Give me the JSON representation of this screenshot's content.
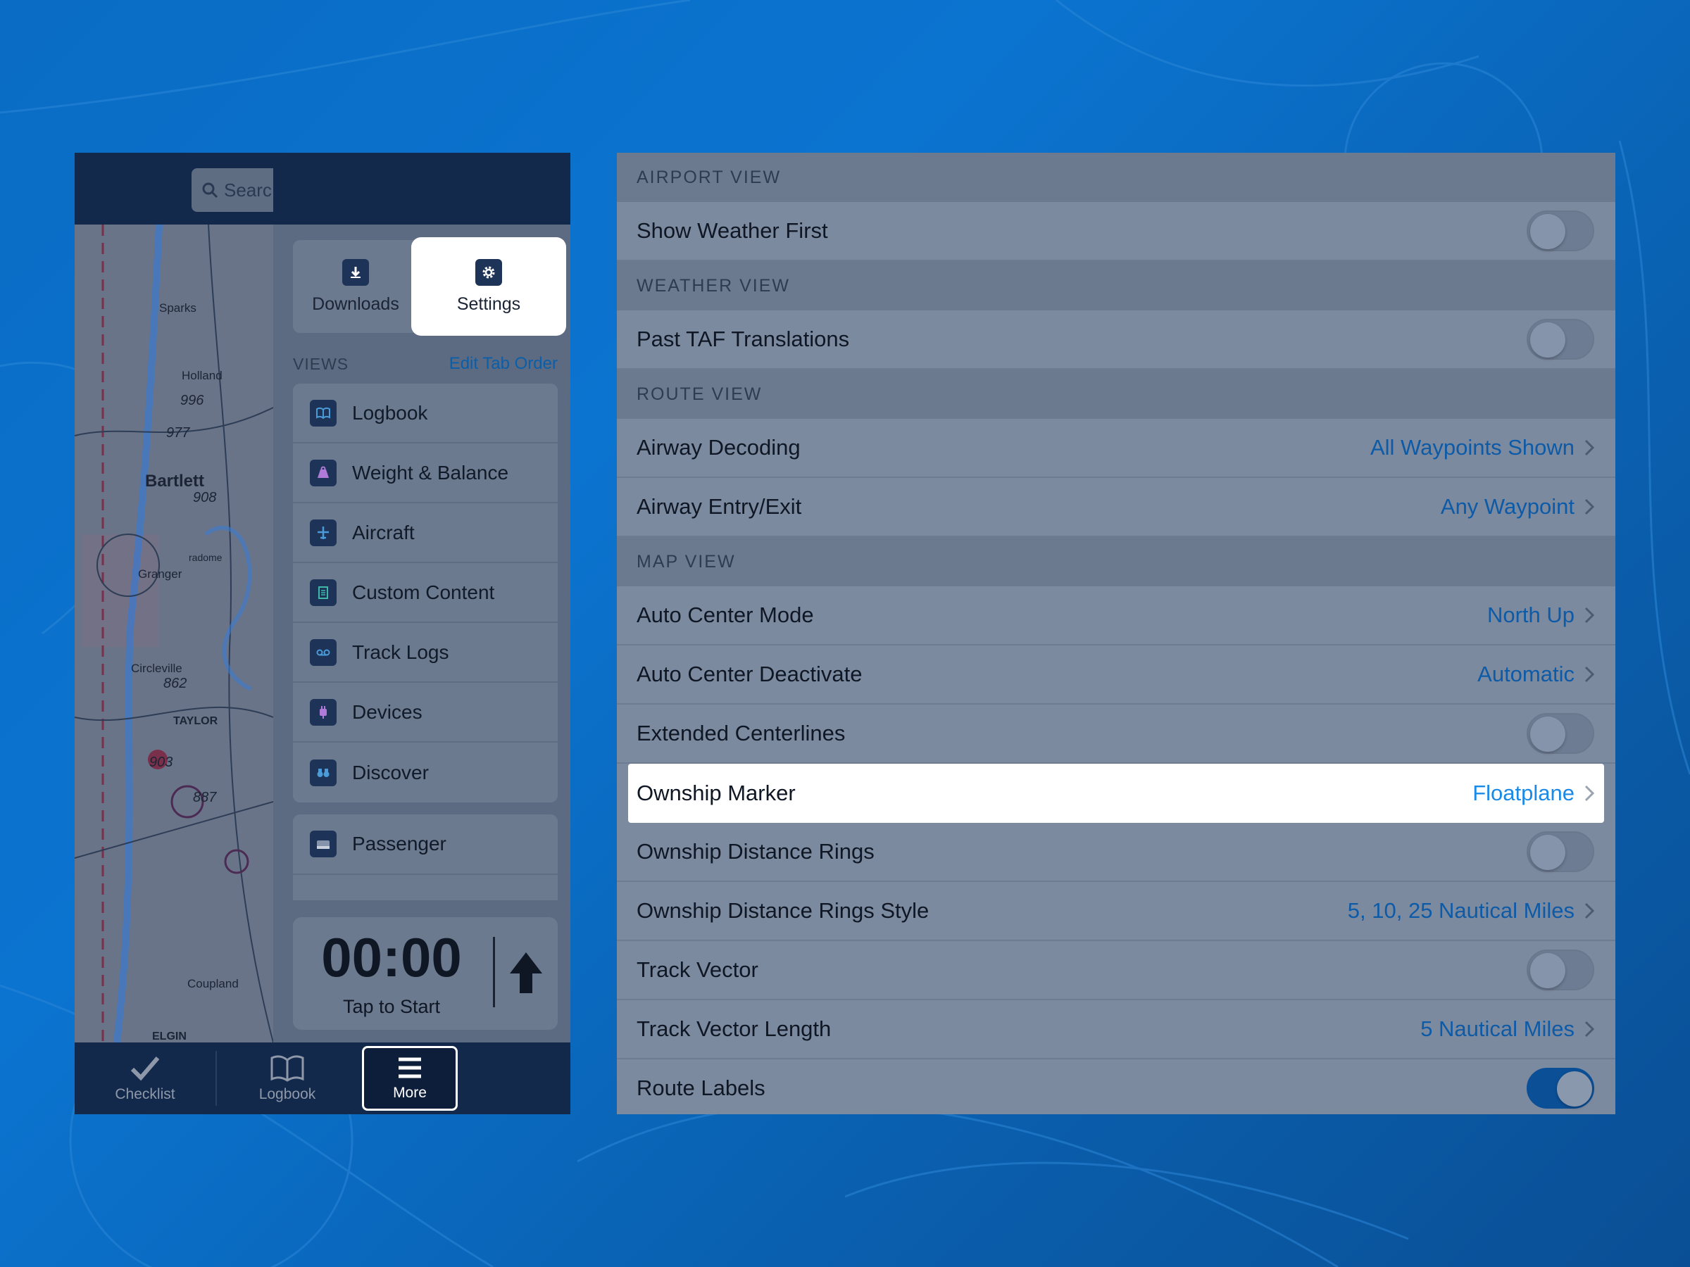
{
  "left": {
    "search_placeholder": "Searc",
    "tiles": {
      "downloads": "Downloads",
      "settings": "Settings"
    },
    "views_title": "VIEWS",
    "edit_tab_order": "Edit Tab Order",
    "views": [
      {
        "label": "Logbook",
        "icon": "book-icon"
      },
      {
        "label": "Weight & Balance",
        "icon": "weight-icon"
      },
      {
        "label": "Aircraft",
        "icon": "plane-icon"
      },
      {
        "label": "Custom Content",
        "icon": "document-icon"
      },
      {
        "label": "Track Logs",
        "icon": "tape-icon"
      },
      {
        "label": "Devices",
        "icon": "plug-icon"
      },
      {
        "label": "Discover",
        "icon": "binoculars-icon"
      }
    ],
    "passenger": "Passenger",
    "timer": {
      "time": "00:00",
      "caption": "Tap to Start"
    },
    "map_labels": {
      "sparks": "Sparks",
      "holland": "Holland",
      "bartlett": "Bartlett",
      "granger": "Granger",
      "circleville": "Circleville",
      "taylor": "TAYLOR",
      "coupland": "Coupland",
      "elgin": "ELGIN",
      "radome": "radome",
      "alt1": "996",
      "alt2": "977",
      "alt3": "908",
      "alt4": "862",
      "alt5": "903",
      "alt6": "887"
    },
    "tabbar": {
      "checklist": "Checklist",
      "logbook": "Logbook",
      "more": "More"
    }
  },
  "right": {
    "sections": [
      {
        "title": "AIRPORT VIEW",
        "rows": [
          {
            "label": "Show Weather First",
            "type": "toggle",
            "on": false
          }
        ]
      },
      {
        "title": "WEATHER VIEW",
        "rows": [
          {
            "label": "Past TAF Translations",
            "type": "toggle",
            "on": false
          }
        ]
      },
      {
        "title": "ROUTE VIEW",
        "rows": [
          {
            "label": "Airway Decoding",
            "type": "value",
            "value": "All Waypoints Shown"
          },
          {
            "label": "Airway Entry/Exit",
            "type": "value",
            "value": "Any Waypoint"
          }
        ]
      },
      {
        "title": "MAP VIEW",
        "rows": [
          {
            "label": "Auto Center Mode",
            "type": "value",
            "value": "North Up"
          },
          {
            "label": "Auto Center Deactivate",
            "type": "value",
            "value": "Automatic"
          },
          {
            "label": "Extended Centerlines",
            "type": "toggle",
            "on": false
          },
          {
            "label": "Ownship Marker",
            "type": "value",
            "value": "Floatplane",
            "highlight": true
          },
          {
            "label": "Ownship Distance Rings",
            "type": "toggle",
            "on": false
          },
          {
            "label": "Ownship Distance Rings Style",
            "type": "value",
            "value": "5, 10, 25 Nautical Miles"
          },
          {
            "label": "Track Vector",
            "type": "toggle",
            "on": false
          },
          {
            "label": "Track Vector Length",
            "type": "value",
            "value": "5 Nautical Miles"
          },
          {
            "label": "Route Labels",
            "type": "toggle",
            "on": true
          }
        ]
      }
    ]
  },
  "colors": {
    "accent": "#0d5aa7",
    "highlight_accent": "#1b8ae6",
    "nav_dark": "#12294b",
    "background": "#0a6cc4"
  }
}
